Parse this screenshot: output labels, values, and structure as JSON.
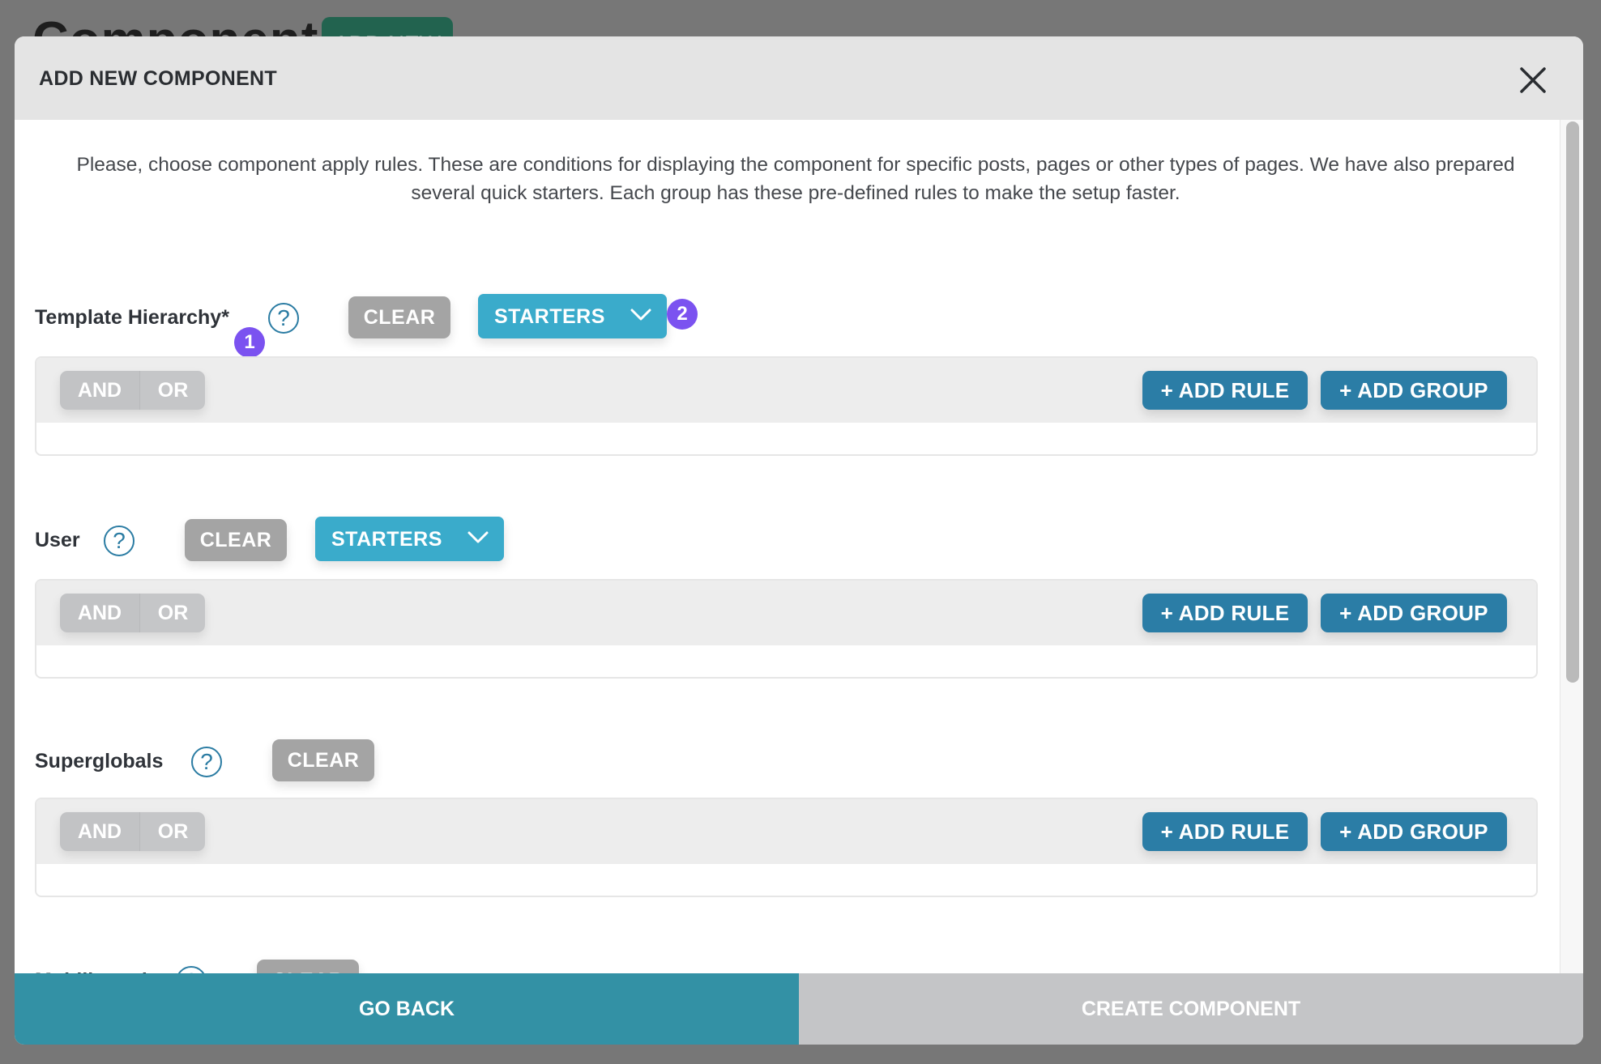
{
  "background": {
    "page_title": "Components",
    "add_new_label": "ADD NEW"
  },
  "modal": {
    "title": "ADD NEW COMPONENT",
    "close_icon": "close-icon",
    "description": "Please, choose component apply rules. These are conditions for displaying the component for specific posts, pages or other types of pages. We have also prepared several quick starters. Each group has these pre-defined rules to make the setup faster.",
    "sections": [
      {
        "label": "Template Hierarchy*",
        "help": "?",
        "clear_label": "CLEAR",
        "starters_label": "STARTERS",
        "has_starters": true,
        "rule_box": {
          "and_label": "AND",
          "or_label": "OR",
          "add_rule_label": "+ ADD RULE",
          "add_group_label": "+ ADD GROUP"
        }
      },
      {
        "label": "User",
        "help": "?",
        "clear_label": "CLEAR",
        "starters_label": "STARTERS",
        "has_starters": true,
        "rule_box": {
          "and_label": "AND",
          "or_label": "OR",
          "add_rule_label": "+ ADD RULE",
          "add_group_label": "+ ADD GROUP"
        }
      },
      {
        "label": "Superglobals",
        "help": "?",
        "clear_label": "CLEAR",
        "has_starters": false,
        "rule_box": {
          "and_label": "AND",
          "or_label": "OR",
          "add_rule_label": "+ ADD RULE",
          "add_group_label": "+ ADD GROUP"
        }
      },
      {
        "label": "Multilingual",
        "help": "?",
        "clear_label": "CLEAR",
        "has_starters": false
      }
    ],
    "annotations": {
      "badge_1": "1",
      "badge_2": "2"
    },
    "footer": {
      "go_back_label": "GO BACK",
      "create_label": "CREATE COMPONENT"
    }
  },
  "colors": {
    "primary_blue": "#2b7da6",
    "starters_blue": "#3aabcb",
    "footer_teal": "#3391a5",
    "clear_gray": "#a4a4a4",
    "disabled_gray": "#c4c5c7",
    "badge_purple": "#7b52f0"
  }
}
